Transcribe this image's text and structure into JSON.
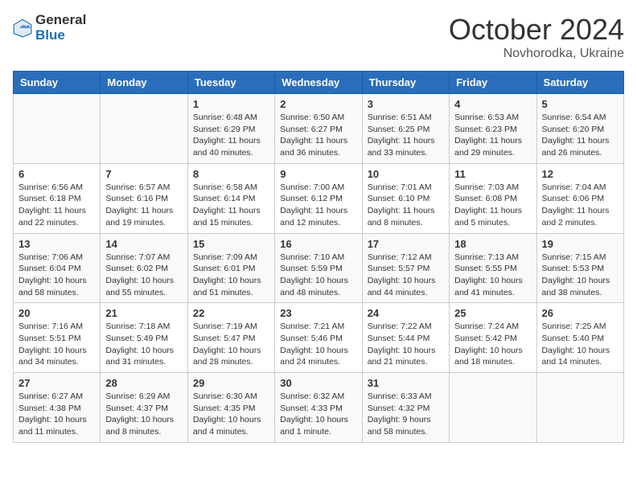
{
  "header": {
    "logo_general": "General",
    "logo_blue": "Blue",
    "title": "October 2024",
    "subtitle": "Novhorodka, Ukraine"
  },
  "columns": [
    "Sunday",
    "Monday",
    "Tuesday",
    "Wednesday",
    "Thursday",
    "Friday",
    "Saturday"
  ],
  "weeks": [
    [
      {
        "day": "",
        "info": ""
      },
      {
        "day": "",
        "info": ""
      },
      {
        "day": "1",
        "info": "Sunrise: 6:48 AM\nSunset: 6:29 PM\nDaylight: 11 hours and 40 minutes."
      },
      {
        "day": "2",
        "info": "Sunrise: 6:50 AM\nSunset: 6:27 PM\nDaylight: 11 hours and 36 minutes."
      },
      {
        "day": "3",
        "info": "Sunrise: 6:51 AM\nSunset: 6:25 PM\nDaylight: 11 hours and 33 minutes."
      },
      {
        "day": "4",
        "info": "Sunrise: 6:53 AM\nSunset: 6:23 PM\nDaylight: 11 hours and 29 minutes."
      },
      {
        "day": "5",
        "info": "Sunrise: 6:54 AM\nSunset: 6:20 PM\nDaylight: 11 hours and 26 minutes."
      }
    ],
    [
      {
        "day": "6",
        "info": "Sunrise: 6:56 AM\nSunset: 6:18 PM\nDaylight: 11 hours and 22 minutes."
      },
      {
        "day": "7",
        "info": "Sunrise: 6:57 AM\nSunset: 6:16 PM\nDaylight: 11 hours and 19 minutes."
      },
      {
        "day": "8",
        "info": "Sunrise: 6:58 AM\nSunset: 6:14 PM\nDaylight: 11 hours and 15 minutes."
      },
      {
        "day": "9",
        "info": "Sunrise: 7:00 AM\nSunset: 6:12 PM\nDaylight: 11 hours and 12 minutes."
      },
      {
        "day": "10",
        "info": "Sunrise: 7:01 AM\nSunset: 6:10 PM\nDaylight: 11 hours and 8 minutes."
      },
      {
        "day": "11",
        "info": "Sunrise: 7:03 AM\nSunset: 6:08 PM\nDaylight: 11 hours and 5 minutes."
      },
      {
        "day": "12",
        "info": "Sunrise: 7:04 AM\nSunset: 6:06 PM\nDaylight: 11 hours and 2 minutes."
      }
    ],
    [
      {
        "day": "13",
        "info": "Sunrise: 7:06 AM\nSunset: 6:04 PM\nDaylight: 10 hours and 58 minutes."
      },
      {
        "day": "14",
        "info": "Sunrise: 7:07 AM\nSunset: 6:02 PM\nDaylight: 10 hours and 55 minutes."
      },
      {
        "day": "15",
        "info": "Sunrise: 7:09 AM\nSunset: 6:01 PM\nDaylight: 10 hours and 51 minutes."
      },
      {
        "day": "16",
        "info": "Sunrise: 7:10 AM\nSunset: 5:59 PM\nDaylight: 10 hours and 48 minutes."
      },
      {
        "day": "17",
        "info": "Sunrise: 7:12 AM\nSunset: 5:57 PM\nDaylight: 10 hours and 44 minutes."
      },
      {
        "day": "18",
        "info": "Sunrise: 7:13 AM\nSunset: 5:55 PM\nDaylight: 10 hours and 41 minutes."
      },
      {
        "day": "19",
        "info": "Sunrise: 7:15 AM\nSunset: 5:53 PM\nDaylight: 10 hours and 38 minutes."
      }
    ],
    [
      {
        "day": "20",
        "info": "Sunrise: 7:16 AM\nSunset: 5:51 PM\nDaylight: 10 hours and 34 minutes."
      },
      {
        "day": "21",
        "info": "Sunrise: 7:18 AM\nSunset: 5:49 PM\nDaylight: 10 hours and 31 minutes."
      },
      {
        "day": "22",
        "info": "Sunrise: 7:19 AM\nSunset: 5:47 PM\nDaylight: 10 hours and 28 minutes."
      },
      {
        "day": "23",
        "info": "Sunrise: 7:21 AM\nSunset: 5:46 PM\nDaylight: 10 hours and 24 minutes."
      },
      {
        "day": "24",
        "info": "Sunrise: 7:22 AM\nSunset: 5:44 PM\nDaylight: 10 hours and 21 minutes."
      },
      {
        "day": "25",
        "info": "Sunrise: 7:24 AM\nSunset: 5:42 PM\nDaylight: 10 hours and 18 minutes."
      },
      {
        "day": "26",
        "info": "Sunrise: 7:25 AM\nSunset: 5:40 PM\nDaylight: 10 hours and 14 minutes."
      }
    ],
    [
      {
        "day": "27",
        "info": "Sunrise: 6:27 AM\nSunset: 4:38 PM\nDaylight: 10 hours and 11 minutes."
      },
      {
        "day": "28",
        "info": "Sunrise: 6:29 AM\nSunset: 4:37 PM\nDaylight: 10 hours and 8 minutes."
      },
      {
        "day": "29",
        "info": "Sunrise: 6:30 AM\nSunset: 4:35 PM\nDaylight: 10 hours and 4 minutes."
      },
      {
        "day": "30",
        "info": "Sunrise: 6:32 AM\nSunset: 4:33 PM\nDaylight: 10 hours and 1 minute."
      },
      {
        "day": "31",
        "info": "Sunrise: 6:33 AM\nSunset: 4:32 PM\nDaylight: 9 hours and 58 minutes."
      },
      {
        "day": "",
        "info": ""
      },
      {
        "day": "",
        "info": ""
      }
    ]
  ]
}
